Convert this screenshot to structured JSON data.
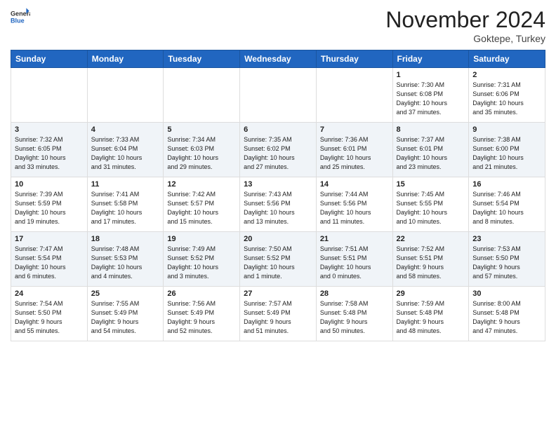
{
  "header": {
    "logo_line1": "General",
    "logo_line2": "Blue",
    "month": "November 2024",
    "location": "Goktepe, Turkey"
  },
  "weekdays": [
    "Sunday",
    "Monday",
    "Tuesday",
    "Wednesday",
    "Thursday",
    "Friday",
    "Saturday"
  ],
  "weeks": [
    [
      {
        "day": "",
        "info": ""
      },
      {
        "day": "",
        "info": ""
      },
      {
        "day": "",
        "info": ""
      },
      {
        "day": "",
        "info": ""
      },
      {
        "day": "",
        "info": ""
      },
      {
        "day": "1",
        "info": "Sunrise: 7:30 AM\nSunset: 6:08 PM\nDaylight: 10 hours\nand 37 minutes."
      },
      {
        "day": "2",
        "info": "Sunrise: 7:31 AM\nSunset: 6:06 PM\nDaylight: 10 hours\nand 35 minutes."
      }
    ],
    [
      {
        "day": "3",
        "info": "Sunrise: 7:32 AM\nSunset: 6:05 PM\nDaylight: 10 hours\nand 33 minutes."
      },
      {
        "day": "4",
        "info": "Sunrise: 7:33 AM\nSunset: 6:04 PM\nDaylight: 10 hours\nand 31 minutes."
      },
      {
        "day": "5",
        "info": "Sunrise: 7:34 AM\nSunset: 6:03 PM\nDaylight: 10 hours\nand 29 minutes."
      },
      {
        "day": "6",
        "info": "Sunrise: 7:35 AM\nSunset: 6:02 PM\nDaylight: 10 hours\nand 27 minutes."
      },
      {
        "day": "7",
        "info": "Sunrise: 7:36 AM\nSunset: 6:01 PM\nDaylight: 10 hours\nand 25 minutes."
      },
      {
        "day": "8",
        "info": "Sunrise: 7:37 AM\nSunset: 6:01 PM\nDaylight: 10 hours\nand 23 minutes."
      },
      {
        "day": "9",
        "info": "Sunrise: 7:38 AM\nSunset: 6:00 PM\nDaylight: 10 hours\nand 21 minutes."
      }
    ],
    [
      {
        "day": "10",
        "info": "Sunrise: 7:39 AM\nSunset: 5:59 PM\nDaylight: 10 hours\nand 19 minutes."
      },
      {
        "day": "11",
        "info": "Sunrise: 7:41 AM\nSunset: 5:58 PM\nDaylight: 10 hours\nand 17 minutes."
      },
      {
        "day": "12",
        "info": "Sunrise: 7:42 AM\nSunset: 5:57 PM\nDaylight: 10 hours\nand 15 minutes."
      },
      {
        "day": "13",
        "info": "Sunrise: 7:43 AM\nSunset: 5:56 PM\nDaylight: 10 hours\nand 13 minutes."
      },
      {
        "day": "14",
        "info": "Sunrise: 7:44 AM\nSunset: 5:56 PM\nDaylight: 10 hours\nand 11 minutes."
      },
      {
        "day": "15",
        "info": "Sunrise: 7:45 AM\nSunset: 5:55 PM\nDaylight: 10 hours\nand 10 minutes."
      },
      {
        "day": "16",
        "info": "Sunrise: 7:46 AM\nSunset: 5:54 PM\nDaylight: 10 hours\nand 8 minutes."
      }
    ],
    [
      {
        "day": "17",
        "info": "Sunrise: 7:47 AM\nSunset: 5:54 PM\nDaylight: 10 hours\nand 6 minutes."
      },
      {
        "day": "18",
        "info": "Sunrise: 7:48 AM\nSunset: 5:53 PM\nDaylight: 10 hours\nand 4 minutes."
      },
      {
        "day": "19",
        "info": "Sunrise: 7:49 AM\nSunset: 5:52 PM\nDaylight: 10 hours\nand 3 minutes."
      },
      {
        "day": "20",
        "info": "Sunrise: 7:50 AM\nSunset: 5:52 PM\nDaylight: 10 hours\nand 1 minute."
      },
      {
        "day": "21",
        "info": "Sunrise: 7:51 AM\nSunset: 5:51 PM\nDaylight: 10 hours\nand 0 minutes."
      },
      {
        "day": "22",
        "info": "Sunrise: 7:52 AM\nSunset: 5:51 PM\nDaylight: 9 hours\nand 58 minutes."
      },
      {
        "day": "23",
        "info": "Sunrise: 7:53 AM\nSunset: 5:50 PM\nDaylight: 9 hours\nand 57 minutes."
      }
    ],
    [
      {
        "day": "24",
        "info": "Sunrise: 7:54 AM\nSunset: 5:50 PM\nDaylight: 9 hours\nand 55 minutes."
      },
      {
        "day": "25",
        "info": "Sunrise: 7:55 AM\nSunset: 5:49 PM\nDaylight: 9 hours\nand 54 minutes."
      },
      {
        "day": "26",
        "info": "Sunrise: 7:56 AM\nSunset: 5:49 PM\nDaylight: 9 hours\nand 52 minutes."
      },
      {
        "day": "27",
        "info": "Sunrise: 7:57 AM\nSunset: 5:49 PM\nDaylight: 9 hours\nand 51 minutes."
      },
      {
        "day": "28",
        "info": "Sunrise: 7:58 AM\nSunset: 5:48 PM\nDaylight: 9 hours\nand 50 minutes."
      },
      {
        "day": "29",
        "info": "Sunrise: 7:59 AM\nSunset: 5:48 PM\nDaylight: 9 hours\nand 48 minutes."
      },
      {
        "day": "30",
        "info": "Sunrise: 8:00 AM\nSunset: 5:48 PM\nDaylight: 9 hours\nand 47 minutes."
      }
    ]
  ]
}
